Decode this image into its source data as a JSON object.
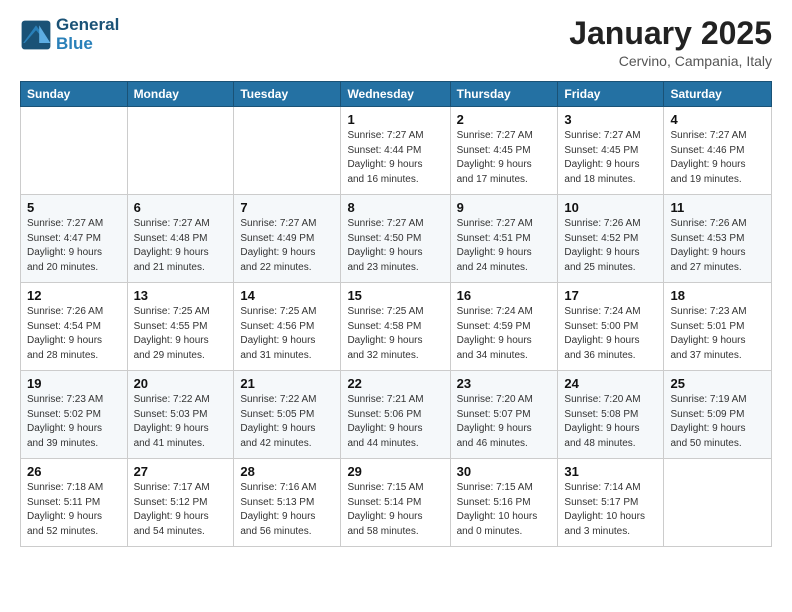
{
  "header": {
    "logo_line1": "General",
    "logo_line2": "Blue",
    "month": "January 2025",
    "location": "Cervino, Campania, Italy"
  },
  "weekdays": [
    "Sunday",
    "Monday",
    "Tuesday",
    "Wednesday",
    "Thursday",
    "Friday",
    "Saturday"
  ],
  "weeks": [
    [
      {
        "day": "",
        "info": ""
      },
      {
        "day": "",
        "info": ""
      },
      {
        "day": "",
        "info": ""
      },
      {
        "day": "1",
        "info": "Sunrise: 7:27 AM\nSunset: 4:44 PM\nDaylight: 9 hours\nand 16 minutes."
      },
      {
        "day": "2",
        "info": "Sunrise: 7:27 AM\nSunset: 4:45 PM\nDaylight: 9 hours\nand 17 minutes."
      },
      {
        "day": "3",
        "info": "Sunrise: 7:27 AM\nSunset: 4:45 PM\nDaylight: 9 hours\nand 18 minutes."
      },
      {
        "day": "4",
        "info": "Sunrise: 7:27 AM\nSunset: 4:46 PM\nDaylight: 9 hours\nand 19 minutes."
      }
    ],
    [
      {
        "day": "5",
        "info": "Sunrise: 7:27 AM\nSunset: 4:47 PM\nDaylight: 9 hours\nand 20 minutes."
      },
      {
        "day": "6",
        "info": "Sunrise: 7:27 AM\nSunset: 4:48 PM\nDaylight: 9 hours\nand 21 minutes."
      },
      {
        "day": "7",
        "info": "Sunrise: 7:27 AM\nSunset: 4:49 PM\nDaylight: 9 hours\nand 22 minutes."
      },
      {
        "day": "8",
        "info": "Sunrise: 7:27 AM\nSunset: 4:50 PM\nDaylight: 9 hours\nand 23 minutes."
      },
      {
        "day": "9",
        "info": "Sunrise: 7:27 AM\nSunset: 4:51 PM\nDaylight: 9 hours\nand 24 minutes."
      },
      {
        "day": "10",
        "info": "Sunrise: 7:26 AM\nSunset: 4:52 PM\nDaylight: 9 hours\nand 25 minutes."
      },
      {
        "day": "11",
        "info": "Sunrise: 7:26 AM\nSunset: 4:53 PM\nDaylight: 9 hours\nand 27 minutes."
      }
    ],
    [
      {
        "day": "12",
        "info": "Sunrise: 7:26 AM\nSunset: 4:54 PM\nDaylight: 9 hours\nand 28 minutes."
      },
      {
        "day": "13",
        "info": "Sunrise: 7:25 AM\nSunset: 4:55 PM\nDaylight: 9 hours\nand 29 minutes."
      },
      {
        "day": "14",
        "info": "Sunrise: 7:25 AM\nSunset: 4:56 PM\nDaylight: 9 hours\nand 31 minutes."
      },
      {
        "day": "15",
        "info": "Sunrise: 7:25 AM\nSunset: 4:58 PM\nDaylight: 9 hours\nand 32 minutes."
      },
      {
        "day": "16",
        "info": "Sunrise: 7:24 AM\nSunset: 4:59 PM\nDaylight: 9 hours\nand 34 minutes."
      },
      {
        "day": "17",
        "info": "Sunrise: 7:24 AM\nSunset: 5:00 PM\nDaylight: 9 hours\nand 36 minutes."
      },
      {
        "day": "18",
        "info": "Sunrise: 7:23 AM\nSunset: 5:01 PM\nDaylight: 9 hours\nand 37 minutes."
      }
    ],
    [
      {
        "day": "19",
        "info": "Sunrise: 7:23 AM\nSunset: 5:02 PM\nDaylight: 9 hours\nand 39 minutes."
      },
      {
        "day": "20",
        "info": "Sunrise: 7:22 AM\nSunset: 5:03 PM\nDaylight: 9 hours\nand 41 minutes."
      },
      {
        "day": "21",
        "info": "Sunrise: 7:22 AM\nSunset: 5:05 PM\nDaylight: 9 hours\nand 42 minutes."
      },
      {
        "day": "22",
        "info": "Sunrise: 7:21 AM\nSunset: 5:06 PM\nDaylight: 9 hours\nand 44 minutes."
      },
      {
        "day": "23",
        "info": "Sunrise: 7:20 AM\nSunset: 5:07 PM\nDaylight: 9 hours\nand 46 minutes."
      },
      {
        "day": "24",
        "info": "Sunrise: 7:20 AM\nSunset: 5:08 PM\nDaylight: 9 hours\nand 48 minutes."
      },
      {
        "day": "25",
        "info": "Sunrise: 7:19 AM\nSunset: 5:09 PM\nDaylight: 9 hours\nand 50 minutes."
      }
    ],
    [
      {
        "day": "26",
        "info": "Sunrise: 7:18 AM\nSunset: 5:11 PM\nDaylight: 9 hours\nand 52 minutes."
      },
      {
        "day": "27",
        "info": "Sunrise: 7:17 AM\nSunset: 5:12 PM\nDaylight: 9 hours\nand 54 minutes."
      },
      {
        "day": "28",
        "info": "Sunrise: 7:16 AM\nSunset: 5:13 PM\nDaylight: 9 hours\nand 56 minutes."
      },
      {
        "day": "29",
        "info": "Sunrise: 7:15 AM\nSunset: 5:14 PM\nDaylight: 9 hours\nand 58 minutes."
      },
      {
        "day": "30",
        "info": "Sunrise: 7:15 AM\nSunset: 5:16 PM\nDaylight: 10 hours\nand 0 minutes."
      },
      {
        "day": "31",
        "info": "Sunrise: 7:14 AM\nSunset: 5:17 PM\nDaylight: 10 hours\nand 3 minutes."
      },
      {
        "day": "",
        "info": ""
      }
    ]
  ]
}
